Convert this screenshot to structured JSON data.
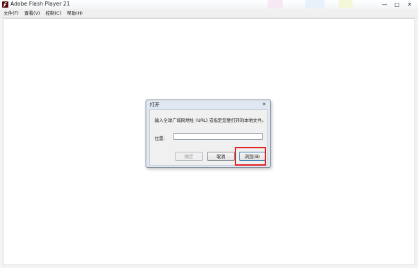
{
  "window": {
    "title": "Adobe Flash Player 21",
    "controls": {
      "minimize": "—",
      "maximize": "□",
      "close": "✕"
    }
  },
  "menubar": {
    "items": [
      "文件(F)",
      "查看(V)",
      "控制(C)",
      "帮助(H)"
    ]
  },
  "dialog": {
    "title": "打开",
    "close": "✕",
    "prompt": "输入全球广域网地址 (URL) 或指定您要打开的本地文件。",
    "location_label": "位置:",
    "location_value": "",
    "buttons": {
      "ok": "确定",
      "cancel": "取消",
      "browse": "浏览(B)"
    }
  },
  "colors": {
    "highlight": "#e02020",
    "app_icon": "#5a0f0f"
  },
  "icons": [
    "flash-app-icon",
    "minimize-icon",
    "maximize-icon",
    "close-icon",
    "dialog-close-icon"
  ]
}
